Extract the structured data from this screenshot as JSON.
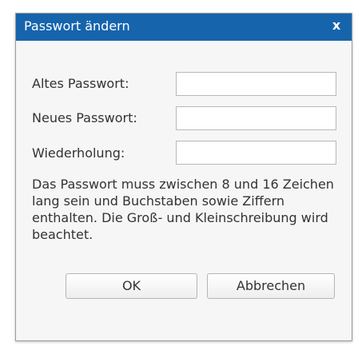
{
  "dialog": {
    "title": "Passwort ändern",
    "close_glyph": "x",
    "fields": {
      "old_password": {
        "label": "Altes Passwort:",
        "value": "",
        "placeholder": ""
      },
      "new_password": {
        "label": "Neues Passwort:",
        "value": "",
        "placeholder": ""
      },
      "repeat": {
        "label": "Wiederholung:",
        "value": "",
        "placeholder": ""
      }
    },
    "help_text": "Das Passwort muss zwischen 8 und 16 Zeichen lang sein und Buchstaben sowie Ziffern enthalten. Die Groß- und Kleinschreibung wird beachtet.",
    "buttons": {
      "ok": "OK",
      "cancel": "Abbrechen"
    }
  },
  "colors": {
    "title_bar": "#1664ac",
    "dialog_body": "#f6f6f6"
  }
}
